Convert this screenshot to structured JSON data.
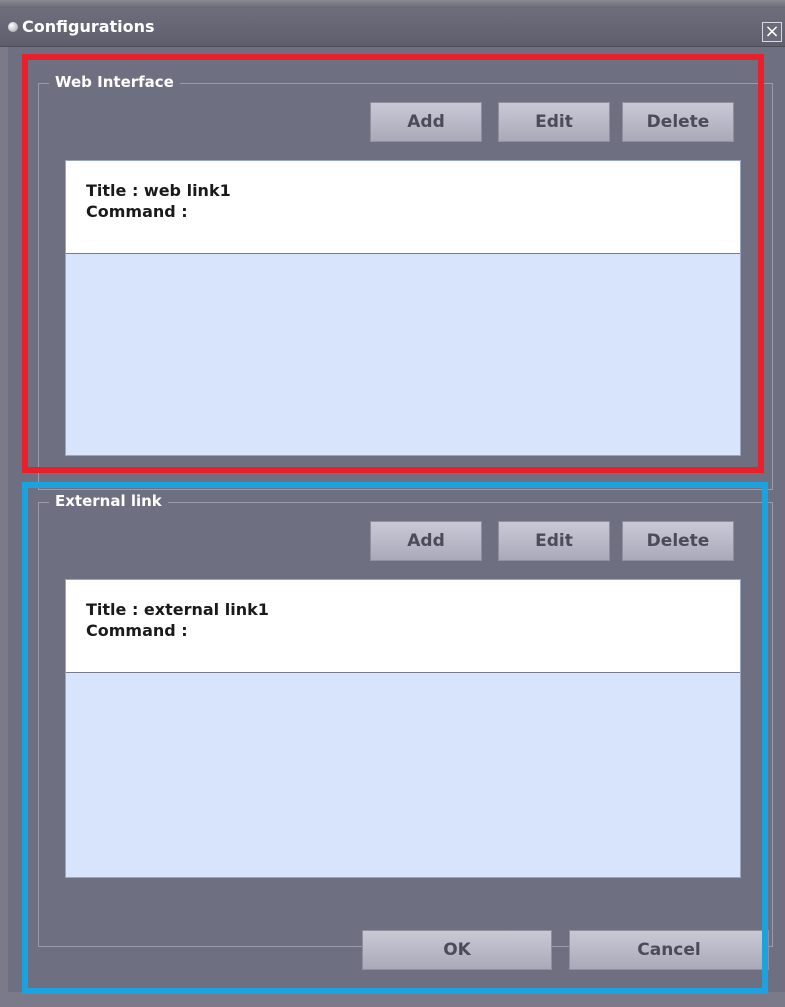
{
  "window": {
    "title": "Configurations",
    "close_glyph": "×"
  },
  "web_interface": {
    "legend": "Web Interface",
    "buttons": {
      "add": "Add",
      "edit": "Edit",
      "delete": "Delete"
    },
    "items": [
      {
        "title_line": "Title : web link1",
        "command_line": "Command :"
      }
    ]
  },
  "external_link": {
    "legend": "External link",
    "buttons": {
      "add": "Add",
      "edit": "Edit",
      "delete": "Delete"
    },
    "items": [
      {
        "title_line": "Title : external link1",
        "command_line": "Command :"
      }
    ]
  },
  "footer": {
    "ok": "OK",
    "cancel": "Cancel"
  },
  "icons": {
    "window_icon": "app-dot-icon",
    "close": "close-icon"
  },
  "colors": {
    "annotation_red": "#e8202c",
    "annotation_blue": "#1ca3df",
    "list_background": "#d8e4fb",
    "dialog_background": "#6f6f82"
  }
}
